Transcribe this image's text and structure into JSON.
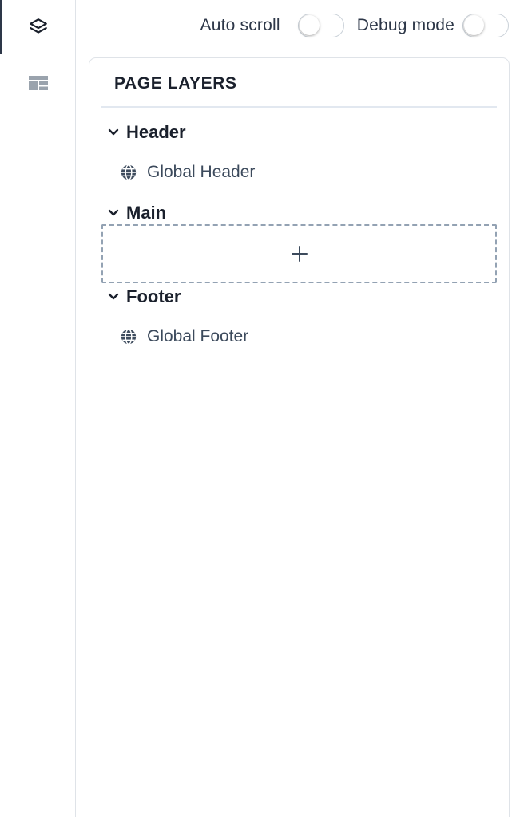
{
  "toolbar": {
    "auto_scroll_label": "Auto scroll",
    "auto_scroll_on": false,
    "debug_mode_label": "Debug mode",
    "debug_mode_on": false
  },
  "rail": {
    "items": [
      {
        "icon": "layers-icon",
        "active": true
      },
      {
        "icon": "blocks-icon",
        "active": false
      }
    ]
  },
  "panel": {
    "title": "PAGE LAYERS",
    "sections": [
      {
        "title": "Header",
        "items": [
          {
            "label": "Global Header",
            "icon": "globe-icon"
          }
        ]
      },
      {
        "title": "Main",
        "items": [],
        "dropzone_icon": "plus-icon"
      },
      {
        "title": "Footer",
        "items": [
          {
            "label": "Global Footer",
            "icon": "globe-icon"
          }
        ]
      }
    ]
  },
  "colors": {
    "text": "#1a202c",
    "muted_text": "#3c4a5c",
    "border": "#dfe3e8",
    "dashed_border": "#93a2b3",
    "active_indicator": "#2d3748"
  }
}
